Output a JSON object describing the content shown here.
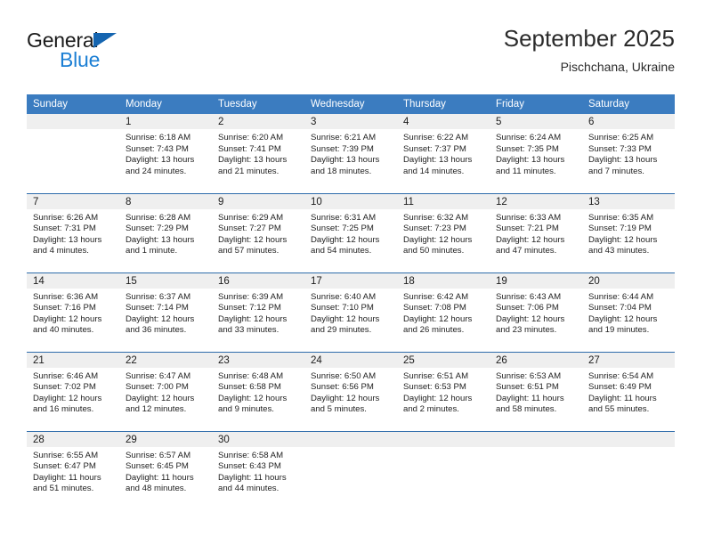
{
  "brand": {
    "name_top": "General",
    "name_bottom": "Blue",
    "accent_color": "#1c7fd4",
    "triangle_color": "#1565b0"
  },
  "header": {
    "title": "September 2025",
    "subtitle": "Pischchana, Ukraine"
  },
  "theme": {
    "header_blue": "#3b7cc0",
    "row_divider_blue": "#2e6cab",
    "daynum_band": "#efefef"
  },
  "calendar": {
    "weekday_headers": [
      "Sunday",
      "Monday",
      "Tuesday",
      "Wednesday",
      "Thursday",
      "Friday",
      "Saturday"
    ],
    "weeks": [
      [
        {
          "day": "",
          "lines": []
        },
        {
          "day": "1",
          "lines": [
            "Sunrise: 6:18 AM",
            "Sunset: 7:43 PM",
            "Daylight: 13 hours",
            "and 24 minutes."
          ]
        },
        {
          "day": "2",
          "lines": [
            "Sunrise: 6:20 AM",
            "Sunset: 7:41 PM",
            "Daylight: 13 hours",
            "and 21 minutes."
          ]
        },
        {
          "day": "3",
          "lines": [
            "Sunrise: 6:21 AM",
            "Sunset: 7:39 PM",
            "Daylight: 13 hours",
            "and 18 minutes."
          ]
        },
        {
          "day": "4",
          "lines": [
            "Sunrise: 6:22 AM",
            "Sunset: 7:37 PM",
            "Daylight: 13 hours",
            "and 14 minutes."
          ]
        },
        {
          "day": "5",
          "lines": [
            "Sunrise: 6:24 AM",
            "Sunset: 7:35 PM",
            "Daylight: 13 hours",
            "and 11 minutes."
          ]
        },
        {
          "day": "6",
          "lines": [
            "Sunrise: 6:25 AM",
            "Sunset: 7:33 PM",
            "Daylight: 13 hours",
            "and 7 minutes."
          ]
        }
      ],
      [
        {
          "day": "7",
          "lines": [
            "Sunrise: 6:26 AM",
            "Sunset: 7:31 PM",
            "Daylight: 13 hours",
            "and 4 minutes."
          ]
        },
        {
          "day": "8",
          "lines": [
            "Sunrise: 6:28 AM",
            "Sunset: 7:29 PM",
            "Daylight: 13 hours",
            "and 1 minute."
          ]
        },
        {
          "day": "9",
          "lines": [
            "Sunrise: 6:29 AM",
            "Sunset: 7:27 PM",
            "Daylight: 12 hours",
            "and 57 minutes."
          ]
        },
        {
          "day": "10",
          "lines": [
            "Sunrise: 6:31 AM",
            "Sunset: 7:25 PM",
            "Daylight: 12 hours",
            "and 54 minutes."
          ]
        },
        {
          "day": "11",
          "lines": [
            "Sunrise: 6:32 AM",
            "Sunset: 7:23 PM",
            "Daylight: 12 hours",
            "and 50 minutes."
          ]
        },
        {
          "day": "12",
          "lines": [
            "Sunrise: 6:33 AM",
            "Sunset: 7:21 PM",
            "Daylight: 12 hours",
            "and 47 minutes."
          ]
        },
        {
          "day": "13",
          "lines": [
            "Sunrise: 6:35 AM",
            "Sunset: 7:19 PM",
            "Daylight: 12 hours",
            "and 43 minutes."
          ]
        }
      ],
      [
        {
          "day": "14",
          "lines": [
            "Sunrise: 6:36 AM",
            "Sunset: 7:16 PM",
            "Daylight: 12 hours",
            "and 40 minutes."
          ]
        },
        {
          "day": "15",
          "lines": [
            "Sunrise: 6:37 AM",
            "Sunset: 7:14 PM",
            "Daylight: 12 hours",
            "and 36 minutes."
          ]
        },
        {
          "day": "16",
          "lines": [
            "Sunrise: 6:39 AM",
            "Sunset: 7:12 PM",
            "Daylight: 12 hours",
            "and 33 minutes."
          ]
        },
        {
          "day": "17",
          "lines": [
            "Sunrise: 6:40 AM",
            "Sunset: 7:10 PM",
            "Daylight: 12 hours",
            "and 29 minutes."
          ]
        },
        {
          "day": "18",
          "lines": [
            "Sunrise: 6:42 AM",
            "Sunset: 7:08 PM",
            "Daylight: 12 hours",
            "and 26 minutes."
          ]
        },
        {
          "day": "19",
          "lines": [
            "Sunrise: 6:43 AM",
            "Sunset: 7:06 PM",
            "Daylight: 12 hours",
            "and 23 minutes."
          ]
        },
        {
          "day": "20",
          "lines": [
            "Sunrise: 6:44 AM",
            "Sunset: 7:04 PM",
            "Daylight: 12 hours",
            "and 19 minutes."
          ]
        }
      ],
      [
        {
          "day": "21",
          "lines": [
            "Sunrise: 6:46 AM",
            "Sunset: 7:02 PM",
            "Daylight: 12 hours",
            "and 16 minutes."
          ]
        },
        {
          "day": "22",
          "lines": [
            "Sunrise: 6:47 AM",
            "Sunset: 7:00 PM",
            "Daylight: 12 hours",
            "and 12 minutes."
          ]
        },
        {
          "day": "23",
          "lines": [
            "Sunrise: 6:48 AM",
            "Sunset: 6:58 PM",
            "Daylight: 12 hours",
            "and 9 minutes."
          ]
        },
        {
          "day": "24",
          "lines": [
            "Sunrise: 6:50 AM",
            "Sunset: 6:56 PM",
            "Daylight: 12 hours",
            "and 5 minutes."
          ]
        },
        {
          "day": "25",
          "lines": [
            "Sunrise: 6:51 AM",
            "Sunset: 6:53 PM",
            "Daylight: 12 hours",
            "and 2 minutes."
          ]
        },
        {
          "day": "26",
          "lines": [
            "Sunrise: 6:53 AM",
            "Sunset: 6:51 PM",
            "Daylight: 11 hours",
            "and 58 minutes."
          ]
        },
        {
          "day": "27",
          "lines": [
            "Sunrise: 6:54 AM",
            "Sunset: 6:49 PM",
            "Daylight: 11 hours",
            "and 55 minutes."
          ]
        }
      ],
      [
        {
          "day": "28",
          "lines": [
            "Sunrise: 6:55 AM",
            "Sunset: 6:47 PM",
            "Daylight: 11 hours",
            "and 51 minutes."
          ]
        },
        {
          "day": "29",
          "lines": [
            "Sunrise: 6:57 AM",
            "Sunset: 6:45 PM",
            "Daylight: 11 hours",
            "and 48 minutes."
          ]
        },
        {
          "day": "30",
          "lines": [
            "Sunrise: 6:58 AM",
            "Sunset: 6:43 PM",
            "Daylight: 11 hours",
            "and 44 minutes."
          ]
        },
        {
          "day": "",
          "lines": []
        },
        {
          "day": "",
          "lines": []
        },
        {
          "day": "",
          "lines": []
        },
        {
          "day": "",
          "lines": []
        }
      ]
    ]
  }
}
